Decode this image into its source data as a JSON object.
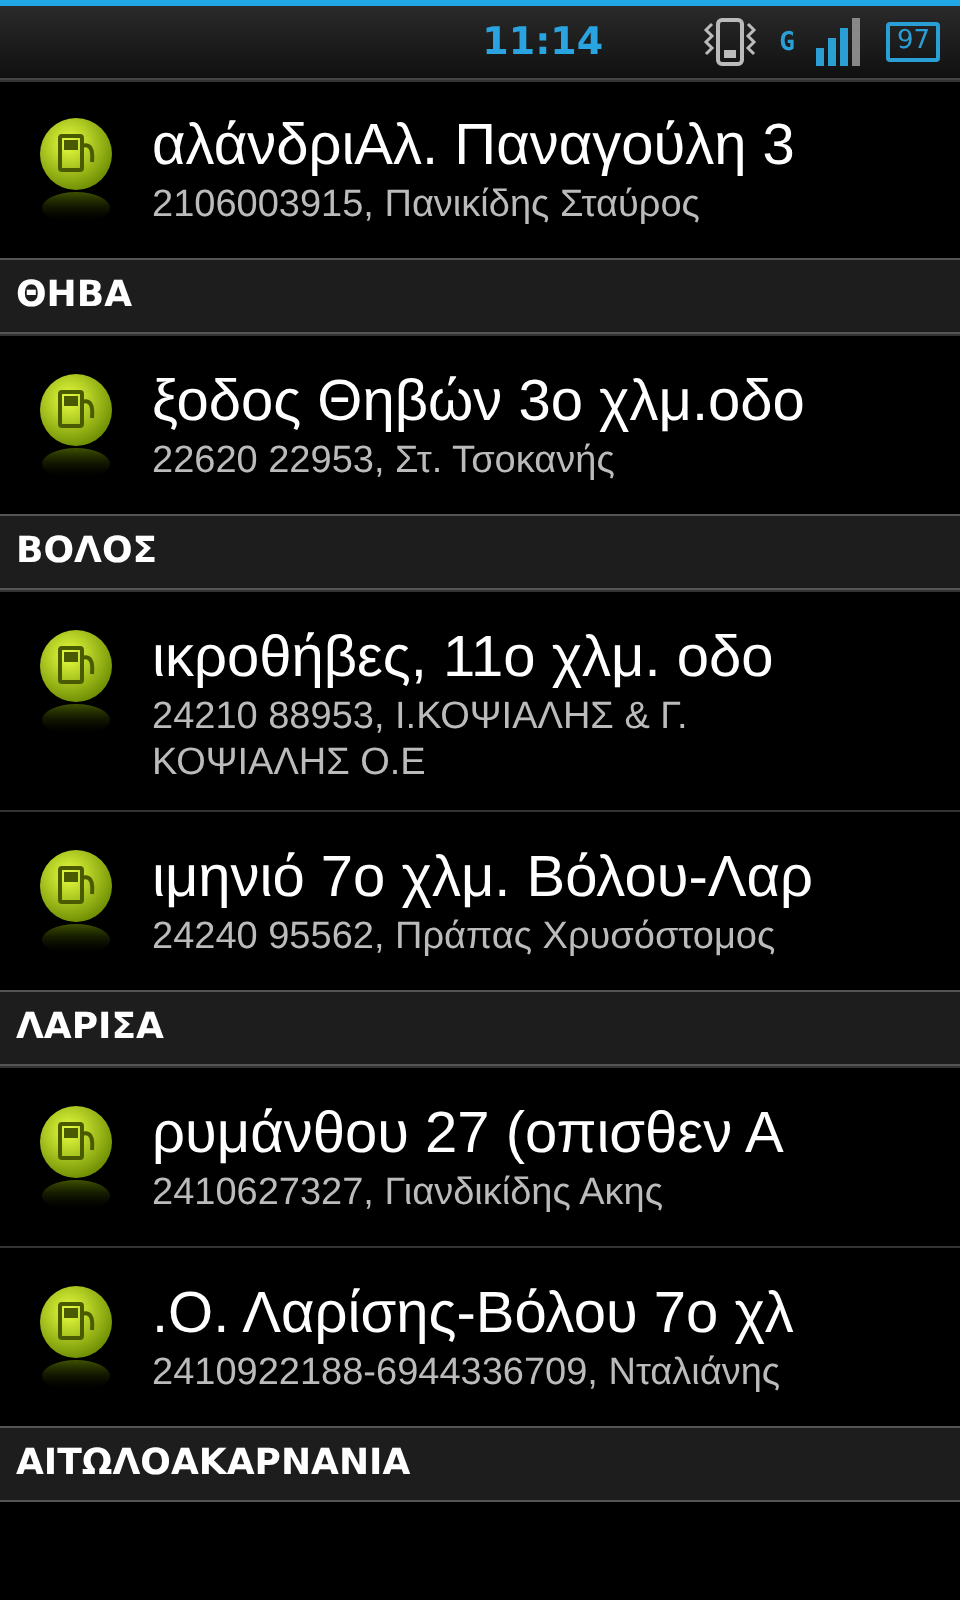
{
  "status_bar": {
    "time": "11:14",
    "battery": "97",
    "network": "G"
  },
  "sections": [
    {
      "stations": [
        {
          "name": "αλάνδριΑλ. Παναγούλη 3",
          "details": "2106003915, Πανικίδης Σταύρος"
        }
      ]
    },
    {
      "heading": "ΘΗΒΑ",
      "stations": [
        {
          "name": "ξοδος Θηβών 3ο χλμ.οδο",
          "details": "22620 22953, Στ. Τσοκανής"
        }
      ]
    },
    {
      "heading": "ΒΟΛΟΣ",
      "stations": [
        {
          "name": "ικροθήβες, 11ο χλμ. οδο",
          "details": "24210 88953, Ι.ΚΟΨΙΑΛΗΣ & Γ. ΚΟΨΙΑΛΗΣ Ο.Ε"
        },
        {
          "name": "ιμηνιό  7ο χλμ. Βόλου-Λαρ",
          "details": "24240 95562, Πράπας Χρυσόστομος"
        }
      ]
    },
    {
      "heading": "ΛΑΡΙΣΑ",
      "stations": [
        {
          "name": "ρυμάνθου 27 (οπισθεν Α",
          "details": "2410627327, Γιανδικίδης Ακης"
        },
        {
          "name": ".Ο. Λαρίσης-Βόλου 7ο χλ",
          "details": "2410922188-6944336709,  Νταλιάνης"
        }
      ]
    },
    {
      "heading": "ΑΙΤΩΛΟΑΚΑΡΝΑΝΙΑ"
    }
  ]
}
